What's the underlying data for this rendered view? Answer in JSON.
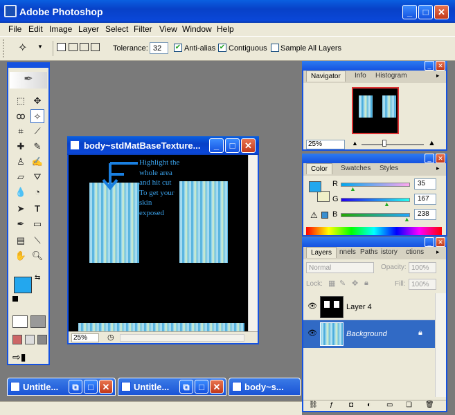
{
  "app": {
    "title": "Adobe Photoshop"
  },
  "menu": [
    "File",
    "Edit",
    "Image",
    "Layer",
    "Select",
    "Filter",
    "View",
    "Window",
    "Help"
  ],
  "options": {
    "tolerance_label": "Tolerance:",
    "tolerance_value": "32",
    "antialias_label": "Anti-alias",
    "antialias_checked": true,
    "contiguous_label": "Contiguous",
    "contiguous_checked": true,
    "sample_label": "Sample All Layers",
    "sample_checked": false
  },
  "document": {
    "title": "body~stdMatBaseTexture...",
    "zoom": "25%",
    "annotation": [
      "Highlight the",
      "whole area",
      "and hit cut",
      "To get your",
      "skin",
      "exposed"
    ]
  },
  "navigator": {
    "tabs": [
      "Navigator",
      "Info",
      "Histogram"
    ],
    "zoom": "25%"
  },
  "color": {
    "tabs": [
      "Color",
      "Swatches",
      "Styles"
    ],
    "r_label": "R",
    "r": "35",
    "g_label": "G",
    "g": "167",
    "b_label": "B",
    "b": "238",
    "foreground": "#23a7ee",
    "background": "#f0f0c8"
  },
  "layers": {
    "tabs": [
      "Layers",
      "nnels",
      "Paths",
      "istory",
      "ctions"
    ],
    "blend": "Normal",
    "opacity_label": "Opacity:",
    "opacity": "100%",
    "lock_label": "Lock:",
    "fill_label": "Fill:",
    "fill": "100%",
    "items": [
      {
        "name": "Layer 4"
      },
      {
        "name": "Background"
      }
    ]
  },
  "taskbar": [
    {
      "title": "Untitle..."
    },
    {
      "title": "Untitle..."
    },
    {
      "title": "body~s..."
    }
  ],
  "colors": {
    "accent": "#1552e0",
    "selection": "#316ac5"
  }
}
